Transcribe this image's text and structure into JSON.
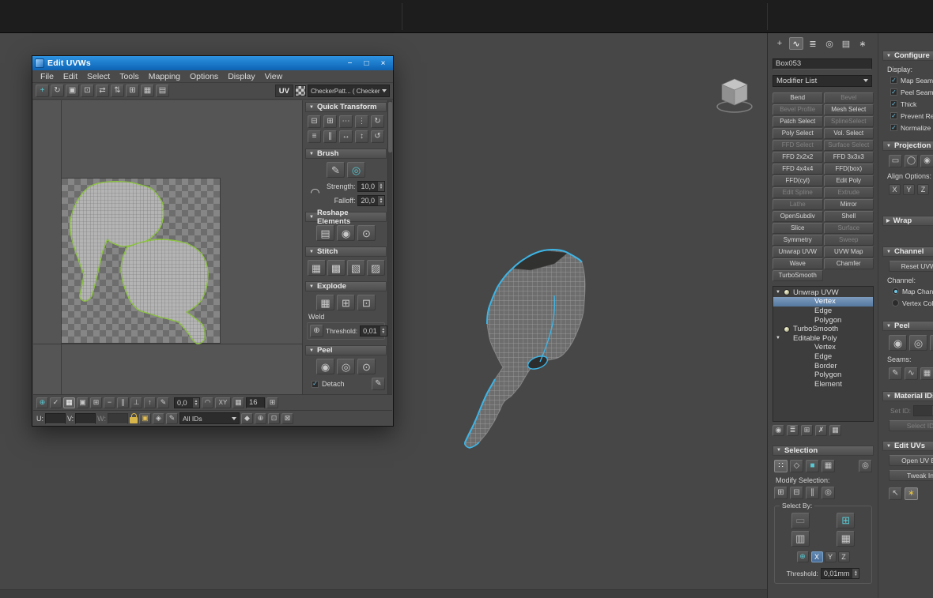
{
  "uvw": {
    "title": "Edit UVWs",
    "controls": {
      "minimize": "−",
      "maximize": "□",
      "close": "×"
    },
    "menus": [
      "File",
      "Edit",
      "Select",
      "Tools",
      "Mapping",
      "Options",
      "Display",
      "View"
    ],
    "toolbar": {
      "uv_label": "UV",
      "texture_value": "CheckerPatt... ( Checker )",
      "icons": [
        {
          "name": "move-tool-icon",
          "glyph": "+",
          "cls": "teal"
        },
        {
          "name": "rotate-tool-icon",
          "glyph": "↻"
        },
        {
          "name": "scale-tool-icon",
          "glyph": "▣"
        },
        {
          "name": "freeform-gizmo-icon",
          "glyph": "⊡"
        },
        {
          "name": "mirror-horizontal-icon",
          "glyph": "⇄"
        },
        {
          "name": "mirror-vertical-icon",
          "glyph": "⇅"
        },
        {
          "name": "snap-grid-icon",
          "glyph": "⊞"
        },
        {
          "name": "pack-uvs-icon",
          "glyph": "▦"
        },
        {
          "name": "render-uv-template-icon",
          "glyph": "▤"
        }
      ]
    },
    "rollouts": {
      "quick_transform": {
        "title": "Quick Transform",
        "icons_row1": [
          {
            "name": "align-horizontal-icon",
            "glyph": "⊟"
          },
          {
            "name": "align-vertical-icon",
            "glyph": "⊞"
          },
          {
            "name": "space-horizontal-icon",
            "glyph": "⋯"
          },
          {
            "name": "space-vertical-icon",
            "glyph": "⋮"
          },
          {
            "name": "rotate-cw-90-icon",
            "glyph": "↻"
          }
        ],
        "icons_row2": [
          {
            "name": "align-to-edge-icon",
            "glyph": "≡"
          },
          {
            "name": "linear-align-icon",
            "glyph": "∥"
          },
          {
            "name": "distribute-horizontal-icon",
            "glyph": "↔"
          },
          {
            "name": "distribute-vertical-icon",
            "glyph": "↕"
          },
          {
            "name": "rotate-ccw-90-icon",
            "glyph": "↺"
          }
        ]
      },
      "brush": {
        "title": "Brush",
        "icons": [
          {
            "name": "paint-move-brush-icon",
            "glyph": "✎"
          },
          {
            "name": "relax-brush-icon",
            "glyph": "◎",
            "cls": "teal"
          }
        ],
        "falloff_curve_glyph": "◠",
        "strength_label": "Strength:",
        "strength_value": "10,0",
        "falloff_label": "Falloff:",
        "falloff_value": "20,0"
      },
      "reshape": {
        "title": "Reshape Elements",
        "icons": [
          {
            "name": "straighten-selection-icon",
            "glyph": "▤"
          },
          {
            "name": "relax-until-flat-icon",
            "glyph": "◉"
          },
          {
            "name": "relax-tool-icon",
            "glyph": "⊙"
          }
        ]
      },
      "stitch": {
        "title": "Stitch",
        "icons": [
          {
            "name": "stitch-custom-icon",
            "glyph": "▦"
          },
          {
            "name": "stitch-to-average-icon",
            "glyph": "▩"
          },
          {
            "name": "stitch-to-source-icon",
            "glyph": "▧"
          },
          {
            "name": "stitch-to-target-icon",
            "glyph": "▨"
          }
        ]
      },
      "explode": {
        "title": "Explode",
        "icons": [
          {
            "name": "flatten-by-smoothing-icon",
            "glyph": "▦"
          },
          {
            "name": "flatten-by-material-icon",
            "glyph": "⊞"
          },
          {
            "name": "flatten-custom-icon",
            "glyph": "⊡"
          }
        ],
        "weld_label": "Weld",
        "weld_icon_glyph": "⊕",
        "threshold_label": "Threshold:",
        "threshold_value": "0,01"
      },
      "peel": {
        "title": "Peel",
        "icons": [
          {
            "name": "quick-peel-icon",
            "glyph": "◉"
          },
          {
            "name": "peel-mode-icon",
            "glyph": "◎"
          },
          {
            "name": "pelt-map-icon",
            "glyph": "⊙"
          }
        ],
        "detach_label": "Detach",
        "edit_seams_glyph": "✎"
      }
    },
    "status1": {
      "icons": [
        {
          "name": "absolute-typein-icon",
          "glyph": "⊕",
          "cls": "teal"
        },
        {
          "name": "show-hidden-edges-icon",
          "glyph": "✓"
        },
        {
          "name": "texture-checker-toggle-icon",
          "glyph": "▦",
          "cls": "teal on"
        },
        {
          "name": "show-map-icon",
          "glyph": "▣"
        },
        {
          "name": "snap-toggle-icon",
          "glyph": "⊞"
        },
        {
          "name": "move-horizontal-icon",
          "glyph": "−"
        },
        {
          "name": "move-vertical-icon",
          "glyph": "∥"
        },
        {
          "name": "snap-center-icon",
          "glyph": "⊥"
        },
        {
          "name": "pixel-snap-icon",
          "glyph": "↑"
        },
        {
          "name": "edit-mode-icon",
          "glyph": "✎"
        }
      ],
      "coord_value": "0,0",
      "arc_glyph": "◠",
      "xy_label": "XY",
      "grid_glyph": "▦",
      "grid_value": "16",
      "last_glyph": "⊞"
    },
    "status2": {
      "u_label": "U:",
      "v_label": "V:",
      "w_label": "W:",
      "ids_value": "All IDs",
      "icons_mid": [
        {
          "name": "lock-selection-icon",
          "glyph": "▣",
          "cls": "amber"
        },
        {
          "name": "filter-selected-faces-icon",
          "glyph": "◈"
        },
        {
          "name": "paint-select-icon",
          "glyph": "✎"
        }
      ],
      "icons_nav": [
        {
          "name": "pan-tool-icon",
          "glyph": "◆"
        },
        {
          "name": "zoom-tool-icon",
          "glyph": "⊕"
        },
        {
          "name": "zoom-region-icon",
          "glyph": "⊡"
        },
        {
          "name": "zoom-extents-icon",
          "glyph": "⊠"
        }
      ]
    }
  },
  "cmd": {
    "tabs": [
      {
        "name": "create-tab-icon",
        "glyph": "+"
      },
      {
        "name": "modify-tab-icon",
        "glyph": "∿",
        "cls": "active"
      },
      {
        "name": "hierarchy-tab-icon",
        "glyph": "≣"
      },
      {
        "name": "motion-tab-icon",
        "glyph": "◎"
      },
      {
        "name": "display-tab-icon",
        "glyph": "▤"
      },
      {
        "name": "utilities-tab-icon",
        "glyph": "∗"
      }
    ],
    "object_name": "Box053",
    "modifier_list_label": "Modifier List",
    "modifier_buttons": [
      {
        "label": "Bend"
      },
      {
        "label": "Bevel",
        "disabled": true
      },
      {
        "label": "Bevel Profile",
        "disabled": true
      },
      {
        "label": "Mesh Select"
      },
      {
        "label": "Patch Select"
      },
      {
        "label": "SplineSelect",
        "disabled": true
      },
      {
        "label": "Poly Select"
      },
      {
        "label": "Vol. Select"
      },
      {
        "label": "FFD Select",
        "disabled": true
      },
      {
        "label": "Surface Select",
        "disabled": true
      },
      {
        "label": "FFD 2x2x2"
      },
      {
        "label": "FFD 3x3x3"
      },
      {
        "label": "FFD 4x4x4"
      },
      {
        "label": "FFD(box)"
      },
      {
        "label": "FFD(cyl)"
      },
      {
        "label": "Edit Poly"
      },
      {
        "label": "Edit Spline",
        "disabled": true
      },
      {
        "label": "Extrude",
        "disabled": true
      },
      {
        "label": "Lathe",
        "disabled": true
      },
      {
        "label": "Mirror"
      },
      {
        "label": "OpenSubdiv"
      },
      {
        "label": "Shell"
      },
      {
        "label": "Slice"
      },
      {
        "label": "Surface",
        "disabled": true
      },
      {
        "label": "Symmetry"
      },
      {
        "label": "Sweep",
        "disabled": true
      },
      {
        "label": "Unwrap UVW"
      },
      {
        "label": "UVW Map"
      },
      {
        "label": "Wave"
      },
      {
        "label": "Chamfer"
      },
      {
        "label": "TurboSmooth"
      }
    ],
    "stack": [
      {
        "label": "Unwrap UVW",
        "cls": "mod hasarrow hasbulb"
      },
      {
        "label": "Vertex",
        "cls": "sub",
        "selected": true
      },
      {
        "label": "Edge",
        "cls": "sub"
      },
      {
        "label": "Polygon",
        "cls": "sub"
      },
      {
        "label": "TurboSmooth",
        "cls": "mod hasbulb"
      },
      {
        "label": "Editable Poly",
        "cls": "mod hasarrow"
      },
      {
        "label": "Vertex",
        "cls": "sub"
      },
      {
        "label": "Edge",
        "cls": "sub"
      },
      {
        "label": "Border",
        "cls": "sub"
      },
      {
        "label": "Polygon",
        "cls": "sub"
      },
      {
        "label": "Element",
        "cls": "sub"
      }
    ],
    "stack_tools": [
      {
        "name": "pin-stack-icon",
        "glyph": "◉"
      },
      {
        "name": "show-end-result-icon",
        "glyph": "≣"
      },
      {
        "name": "make-unique-icon",
        "glyph": "⊞"
      },
      {
        "name": "remove-modifier-icon",
        "glyph": "✗"
      },
      {
        "name": "configure-modifier-sets-icon",
        "glyph": "▦"
      }
    ],
    "selection": {
      "title": "Selection",
      "mode_icons": [
        {
          "name": "vertex-mode-icon",
          "glyph": "∷",
          "cls": "on"
        },
        {
          "name": "edge-mode-icon",
          "glyph": "◇"
        },
        {
          "name": "polygon-mode-icon",
          "glyph": "■",
          "cls": "teal"
        },
        {
          "name": "element-mode-icon",
          "glyph": "▦"
        },
        {
          "name": "soft-selection-icon",
          "glyph": "◎",
          "cls": "push"
        }
      ],
      "modify_label": "Modify Selection:",
      "modify_icons": [
        {
          "name": "grow-selection-icon",
          "glyph": "⊞"
        },
        {
          "name": "shrink-selection-icon",
          "glyph": "⊟"
        },
        {
          "name": "ring-selection-icon",
          "glyph": "∥"
        },
        {
          "name": "loop-selection-icon",
          "glyph": "◎"
        }
      ],
      "select_by_label": "Select By:",
      "sb_row1": [
        {
          "name": "planar-threshold-icon",
          "glyph": "▭",
          "cls": "dim"
        },
        {
          "name": "select-by-cube-icon",
          "glyph": "⊞",
          "cls": "teal"
        }
      ],
      "sb_row2": [
        {
          "name": "select-by-material-icon",
          "glyph": "▥"
        },
        {
          "name": "select-by-smoothing-icon",
          "glyph": "▦"
        }
      ],
      "axis_icon": {
        "glyph": "⊕"
      },
      "axis": [
        {
          "label": "X",
          "cls": "on"
        },
        {
          "label": "Y"
        },
        {
          "label": "Z"
        }
      ],
      "threshold_label": "Threshold:",
      "threshold_value": "0,01mm"
    }
  },
  "params": {
    "configure_title": "Configure",
    "display_label": "Display:",
    "display_checks": [
      {
        "name": "map-seams-checkbox",
        "label": "Map Seams",
        "checked": true
      },
      {
        "name": "peel-seams-checkbox",
        "label": "Peel Seams",
        "checked": true
      },
      {
        "name": "thick-checkbox",
        "label": "Thick",
        "checked": true
      },
      {
        "name": "prevent-reflattening-checkbox",
        "label": "Prevent Refla",
        "checked": true
      },
      {
        "name": "normalize-map-checkbox",
        "label": "Normalize Map",
        "checked": true
      }
    ],
    "projection_title": "Projection",
    "projection_icons": [
      {
        "name": "planar-map-icon",
        "glyph": "▭"
      },
      {
        "name": "cylindrical-map-icon",
        "glyph": "◯"
      },
      {
        "name": "spherical-map-icon",
        "glyph": "◉"
      },
      {
        "name": "box-map-icon",
        "glyph": "▣"
      }
    ],
    "align_label": "Align Options:",
    "axis": [
      "X",
      "Y",
      "Z"
    ],
    "wrap_title": "Wrap",
    "channel_title": "Channel",
    "reset_uvws_label": "Reset UVWs",
    "channel_label": "Channel:",
    "radios": [
      {
        "label": "Map Channel",
        "selected": true
      },
      {
        "label": "Vertex Color"
      }
    ],
    "peel_title": "Peel",
    "peel_icons": [
      {
        "name": "quick-peel-icon",
        "glyph": "◉"
      },
      {
        "name": "peel-mode-icon",
        "glyph": "◎"
      },
      {
        "name": "reset-peel-icon",
        "glyph": "⊙"
      }
    ],
    "seams_label": "Seams:",
    "seams_icons": [
      {
        "name": "edit-seams-icon",
        "glyph": "✎"
      },
      {
        "name": "point-to-point-seam-icon",
        "glyph": "∿"
      },
      {
        "name": "edge-to-seam-icon",
        "glyph": "▦"
      },
      {
        "name": "expand-seam-icon",
        "glyph": "⊕"
      }
    ],
    "material_title": "Material IDs",
    "set_id_label": "Set ID:",
    "set_id_value": "",
    "select_id_label": "Select ID",
    "edituvs_title": "Edit UVs",
    "open_uv_label": "Open UV Ed",
    "tweak_label": "Tweak In",
    "bottom_icons": [
      {
        "name": "select-cursor-icon",
        "glyph": "↖"
      },
      {
        "name": "isolate-selection-icon",
        "glyph": "∗",
        "cls": "yellow on"
      }
    ]
  }
}
